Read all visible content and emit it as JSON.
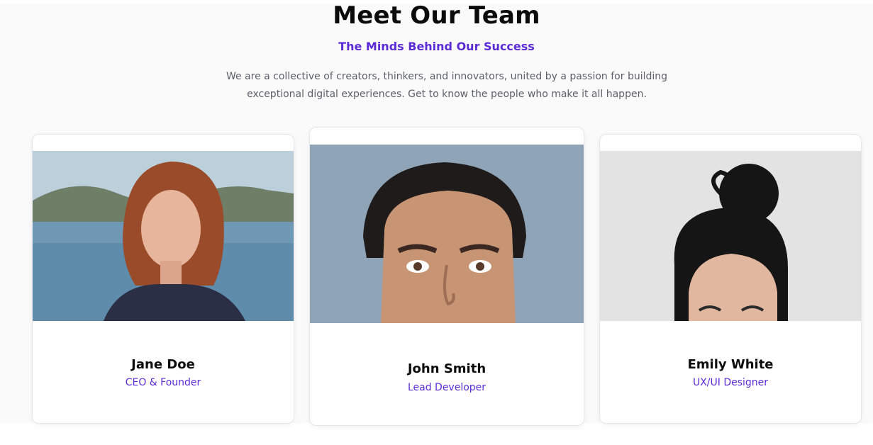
{
  "header": {
    "title": "Meet Our Team",
    "subtitle": "The Minds Behind Our Success",
    "description": "We are a collective of creators, thinkers, and innovators, united by a passion for building exceptional digital experiences. Get to know the people who make it all happen."
  },
  "team": [
    {
      "name": "Jane Doe",
      "role": "CEO & Founder"
    },
    {
      "name": "John Smith",
      "role": "Lead Developer"
    },
    {
      "name": "Emily White",
      "role": "UX/UI Designer"
    }
  ],
  "colors": {
    "accent": "#5b2bd6",
    "heading": "#0b0b0b",
    "body_text": "#5f5f6a",
    "section_bg": "#fafafa"
  }
}
